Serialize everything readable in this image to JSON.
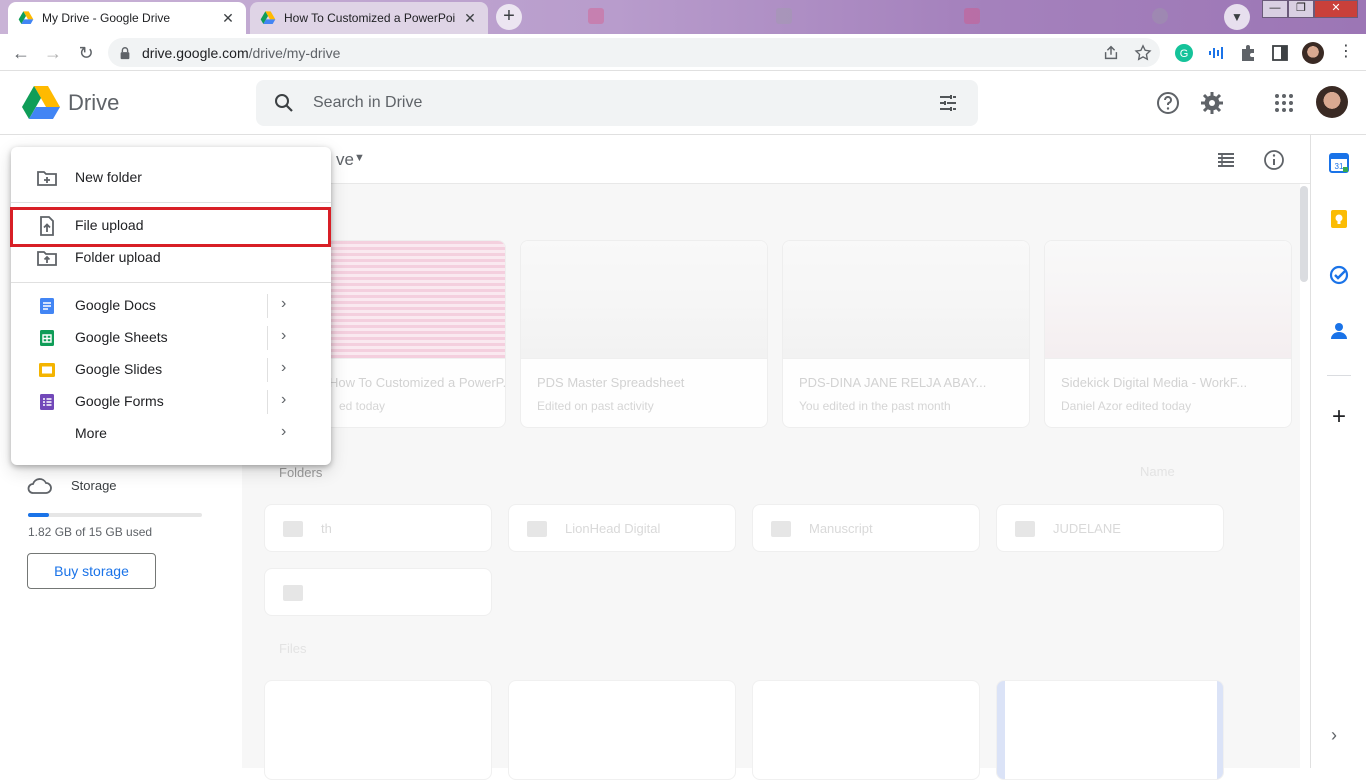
{
  "browser": {
    "tabs": [
      {
        "title": "My Drive - Google Drive",
        "active": true
      },
      {
        "title": "How To Customized a PowerPoin",
        "active": false
      }
    ],
    "url_host": "drive.google.com",
    "url_path": "/drive/my-drive"
  },
  "drive": {
    "app_name": "Drive",
    "search_placeholder": "Search in Drive",
    "breadcrumb": "ve",
    "view": {
      "folders_label": "Folders",
      "files_label": "Files",
      "sort_label": "Name",
      "suggested": [
        {
          "name": "How To Customized a PowerP...",
          "meta": "ed today"
        },
        {
          "name": "PDS Master Spreadsheet",
          "meta": "Edited on past activity"
        },
        {
          "name": "PDS-DINA JANE RELJA ABAY...",
          "meta": "You edited in the past month"
        },
        {
          "name": "Sidekick Digital Media - WorkF...",
          "meta": "Daniel Azor edited today"
        }
      ],
      "folders": [
        "th",
        "LionHead Digital",
        "Manuscript",
        "JUDELANE",
        ""
      ]
    },
    "storage": {
      "label": "Storage",
      "used_text": "1.82 GB of 15 GB used",
      "used_fraction": 0.121,
      "buy_label": "Buy storage"
    }
  },
  "new_menu": {
    "items": [
      {
        "label": "New folder",
        "icon": "new-folder-icon"
      },
      {
        "label": "File upload",
        "icon": "file-upload-icon",
        "highlighted": true
      },
      {
        "label": "Folder upload",
        "icon": "folder-upload-icon"
      },
      {
        "label": "Google Docs",
        "icon": "google-docs-icon",
        "submenu": true
      },
      {
        "label": "Google Sheets",
        "icon": "google-sheets-icon",
        "submenu": true
      },
      {
        "label": "Google Slides",
        "icon": "google-slides-icon",
        "submenu": true
      },
      {
        "label": "Google Forms",
        "icon": "google-forms-icon",
        "submenu": true
      },
      {
        "label": "More",
        "icon": "",
        "submenu": true
      }
    ],
    "highlight_color": "#d81f26"
  },
  "colors": {
    "accent": "#1a73e8",
    "tabbar": "#b89ccc"
  }
}
